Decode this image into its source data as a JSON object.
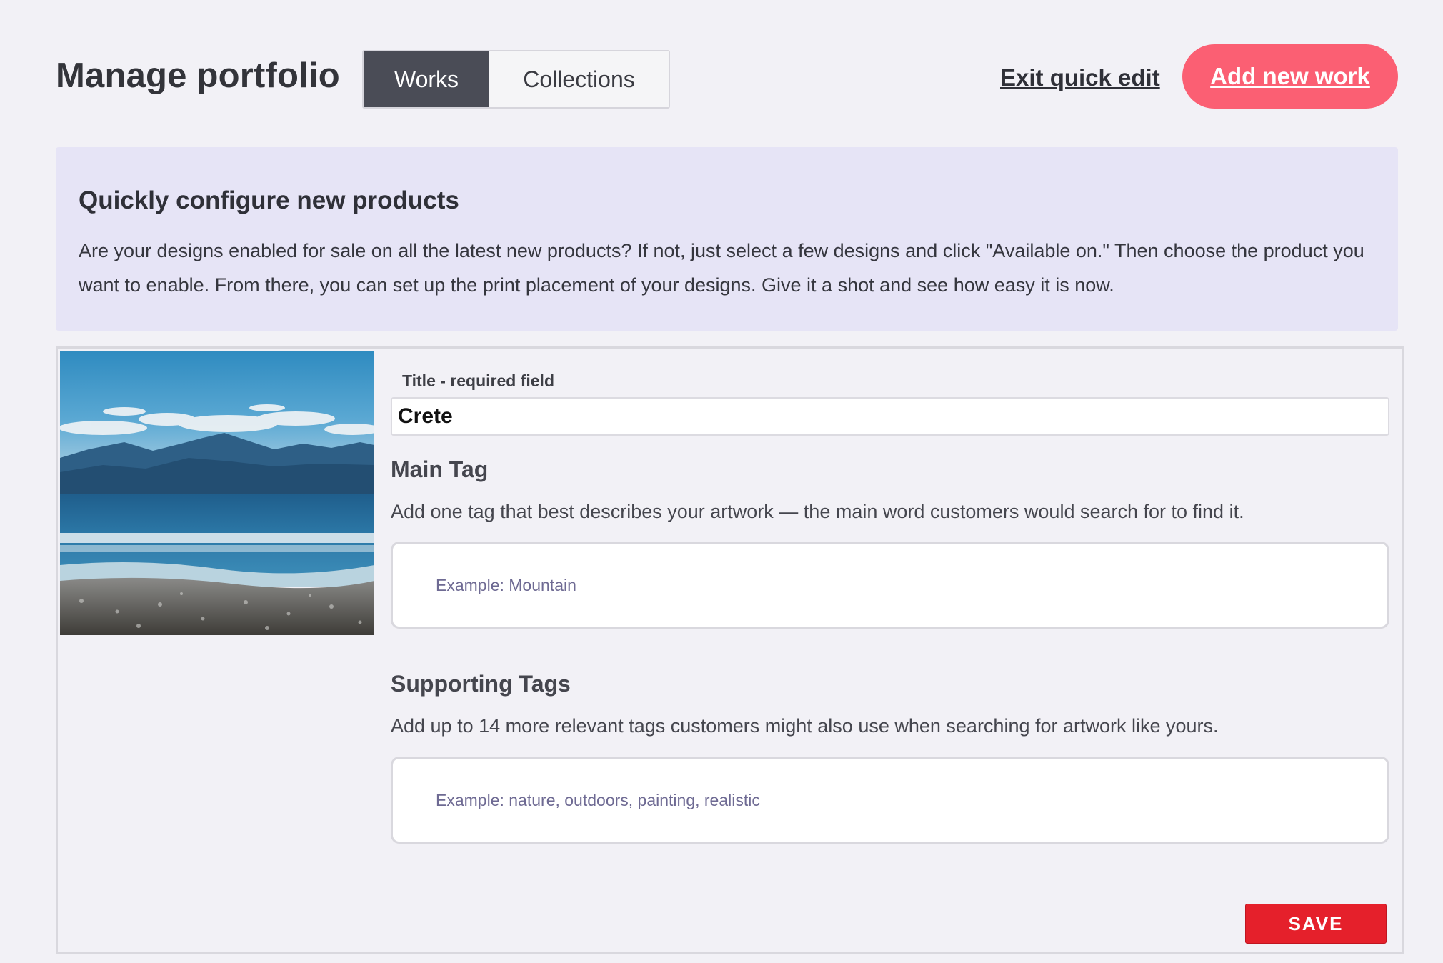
{
  "header": {
    "title": "Manage portfolio",
    "tabs": [
      {
        "label": "Works",
        "active": true
      },
      {
        "label": "Collections",
        "active": false
      }
    ],
    "exit_link": "Exit quick edit",
    "add_button": "Add new work"
  },
  "info": {
    "title": "Quickly configure new products",
    "body": "Are your designs enabled for sale on all the latest new products? If not, just select a few designs and click \"Available on.\" Then choose the product you want to enable. From there, you can set up the print placement of your designs. Give it a shot and see how easy it is now."
  },
  "work": {
    "title_label": "Title - required field",
    "title_value": "Crete",
    "main_tag": {
      "heading": "Main Tag",
      "description": "Add one tag that best describes your artwork — the main word customers would search for to find it.",
      "placeholder": "Example: Mountain"
    },
    "supporting_tags": {
      "heading": "Supporting Tags",
      "description": "Add up to 14 more relevant tags customers might also use when searching for artwork like yours.",
      "placeholder": "Example: nature, outdoors, painting, realistic"
    },
    "save_button": "SAVE"
  },
  "colors": {
    "background": "#f2f1f6",
    "accent": "#fb5f73",
    "save": "#e5202b",
    "info_panel": "#e6e4f6",
    "active_tab": "#4a4c56"
  }
}
